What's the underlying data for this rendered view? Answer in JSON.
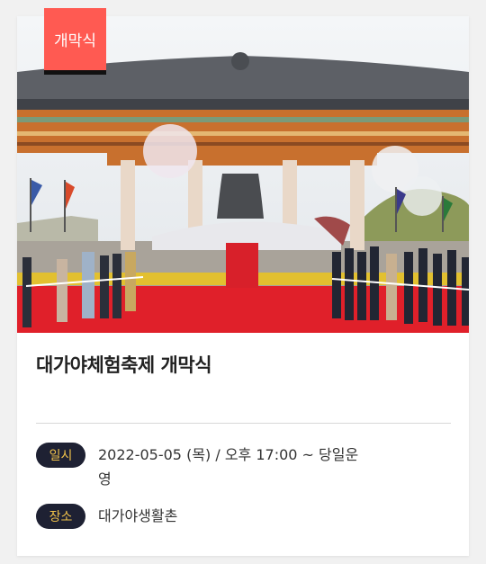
{
  "badge": {
    "label": "개막식"
  },
  "event": {
    "title": "대가야체험축제 개막식",
    "date_label": "일시",
    "date_value": "2022-05-05 (목) / 오후 17:00 ~ 당일운영",
    "place_label": "장소",
    "place_value": "대가야생활촌"
  },
  "photo": {
    "icon": "event-photo"
  },
  "colors": {
    "badge": "#ff5a52",
    "pill_bg": "#1e2133",
    "pill_text": "#f0c24a",
    "carpet": "#e0202a"
  }
}
